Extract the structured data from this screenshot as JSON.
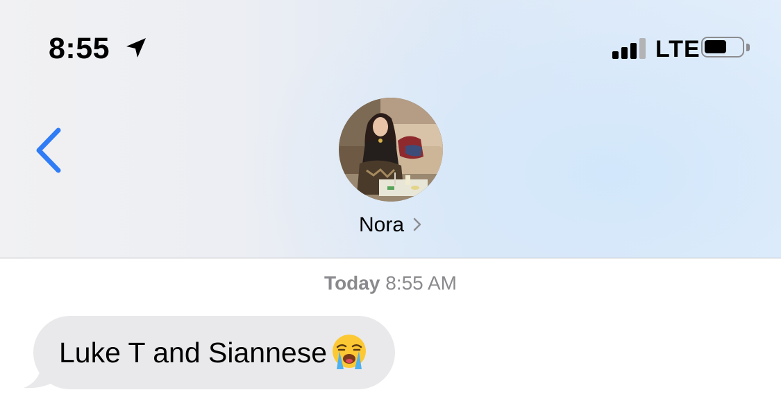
{
  "status_bar": {
    "time": "8:55",
    "location_icon": "location-arrow-icon",
    "signal_bars": 3,
    "signal_total": 4,
    "network": "LTE",
    "battery_level": 0.6
  },
  "nav": {
    "back_icon": "chevron-left-icon",
    "contact_name": "Nora",
    "contact_chevron_icon": "chevron-right-icon",
    "avatar_icon": "contact-photo"
  },
  "thread": {
    "timestamp_day": "Today",
    "timestamp_time": "8:55 AM",
    "messages": [
      {
        "direction": "incoming",
        "text": "Luke T and Siannese",
        "emoji": "loudly-crying-face-emoji"
      }
    ]
  },
  "colors": {
    "accent_blue": "#2f7cf6",
    "incoming_bubble": "#e9e9eb",
    "timestamp_gray": "#8a8a8e"
  }
}
